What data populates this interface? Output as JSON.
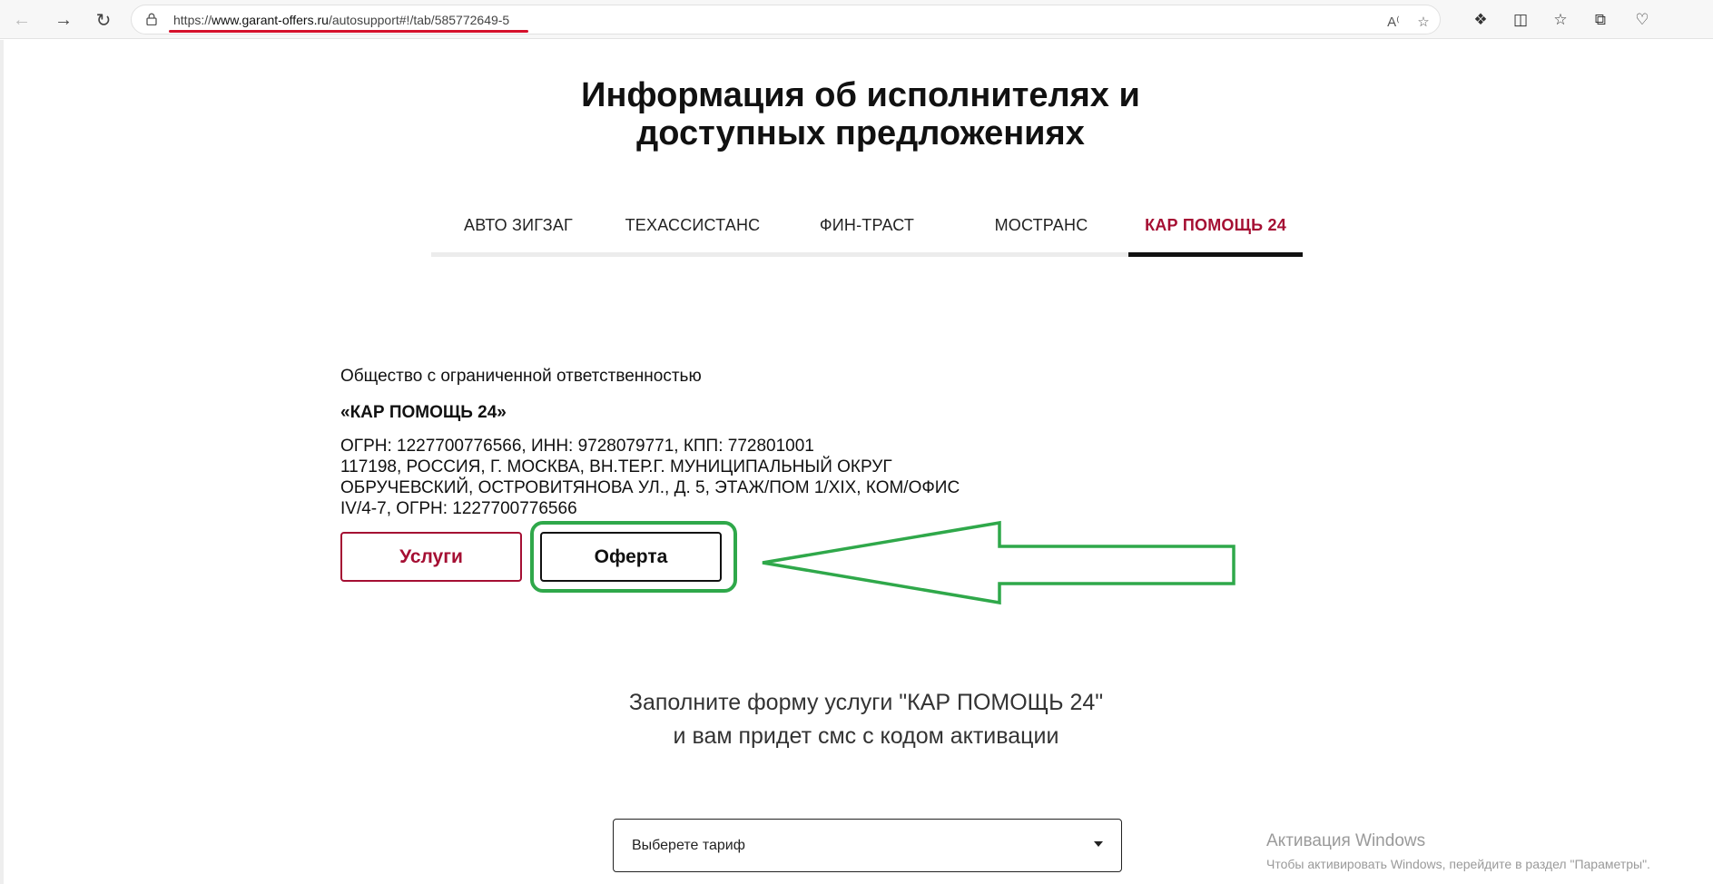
{
  "browser": {
    "url_prefix": "https://",
    "url_host": "www.garant-offers.ru",
    "url_path": "/autosupport#!/tab/585772649-5",
    "icons": [
      "back-arrow-icon",
      "forward-arrow-icon",
      "refresh-icon",
      "lock-icon",
      "read-aloud-icon",
      "favorite-star-icon",
      "extensions-icon",
      "split-screen-icon",
      "favorites-list-icon",
      "collections-icon",
      "browser-essentials-icon"
    ]
  },
  "page": {
    "title_line1": "Информация об исполнителях и",
    "title_line2": "доступных предложениях",
    "tabs": [
      {
        "label": "АВТО ЗИГЗАГ"
      },
      {
        "label": "ТЕХАССИСТАНС"
      },
      {
        "label": "ФИН-ТРАСТ"
      },
      {
        "label": "МОСТРАНС"
      },
      {
        "label": "КАР ПОМОЩЬ 24"
      }
    ],
    "company": {
      "legal_form": "Общество с ограниченной ответственностью",
      "name": "«КАР ПОМОЩЬ 24»",
      "req_line1": "ОГРН: 1227700776566, ИНН: 9728079771, КПП: 772801001",
      "req_line2": "117198, РОССИЯ, Г. МОСКВА, ВН.ТЕР.Г. МУНИЦИПАЛЬНЫЙ ОКРУГ",
      "req_line3": "ОБРУЧЕВСКИЙ, ОСТРОВИТЯНОВА УЛ., Д. 5, ЭТАЖ/ПОМ 1/XIX, КОМ/ОФИС",
      "req_line4": "IV/4-7, ОГРН: 1227700776566"
    },
    "buttons": {
      "services": "Услуги",
      "offer": "Оферта"
    },
    "subtitle_line1": "Заполните форму услуги \"КАР ПОМОЩЬ 24\"",
    "subtitle_line2": "и вам придет смс с кодом активации",
    "tariff_select": {
      "value": "Выберете тариф"
    }
  },
  "overlay": {
    "windows_activation_title": "Активация Windows",
    "windows_activation_text": "Чтобы активировать Windows, перейдите в раздел \"Параметры\"."
  },
  "colors": {
    "accent": "#a50f33",
    "highlight_green": "#2fa84a",
    "url_underline": "#d5102b"
  }
}
